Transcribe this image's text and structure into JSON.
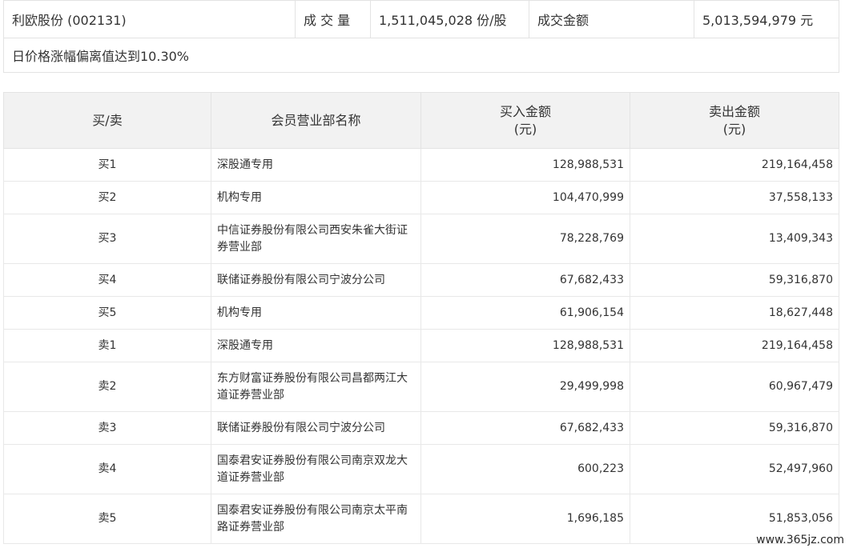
{
  "summary": {
    "stock_name": "利欧股份 (002131)",
    "volume_label": "成 交 量",
    "volume_value": "1,511,045,028 份/股",
    "amount_label": "成交金额",
    "amount_value": "5,013,594,979 元",
    "reason": "日价格涨幅偏离值达到10.30%"
  },
  "table": {
    "headers": {
      "side": "买/卖",
      "broker": "会员营业部名称",
      "buy_line1": "买入金额",
      "buy_line2": "(元)",
      "sell_line1": "卖出金额",
      "sell_line2": "(元)"
    },
    "rows": [
      {
        "side": "买1",
        "broker": "深股通专用",
        "buy": "128,988,531",
        "sell": "219,164,458"
      },
      {
        "side": "买2",
        "broker": "机构专用",
        "buy": "104,470,999",
        "sell": "37,558,133"
      },
      {
        "side": "买3",
        "broker": "中信证券股份有限公司西安朱雀大街证券营业部",
        "buy": "78,228,769",
        "sell": "13,409,343"
      },
      {
        "side": "买4",
        "broker": "联储证券股份有限公司宁波分公司",
        "buy": "67,682,433",
        "sell": "59,316,870"
      },
      {
        "side": "买5",
        "broker": "机构专用",
        "buy": "61,906,154",
        "sell": "18,627,448"
      },
      {
        "side": "卖1",
        "broker": "深股通专用",
        "buy": "128,988,531",
        "sell": "219,164,458"
      },
      {
        "side": "卖2",
        "broker": "东方财富证券股份有限公司昌都两江大道证券营业部",
        "buy": "29,499,998",
        "sell": "60,967,479"
      },
      {
        "side": "卖3",
        "broker": "联储证券股份有限公司宁波分公司",
        "buy": "67,682,433",
        "sell": "59,316,870"
      },
      {
        "side": "卖4",
        "broker": "国泰君安证券股份有限公司南京双龙大道证券营业部",
        "buy": "600,223",
        "sell": "52,497,960"
      },
      {
        "side": "卖5",
        "broker": "国泰君安证券股份有限公司南京太平南路证券营业部",
        "buy": "1,696,185",
        "sell": "51,853,056"
      }
    ]
  },
  "watermark": "www.365jz.com"
}
